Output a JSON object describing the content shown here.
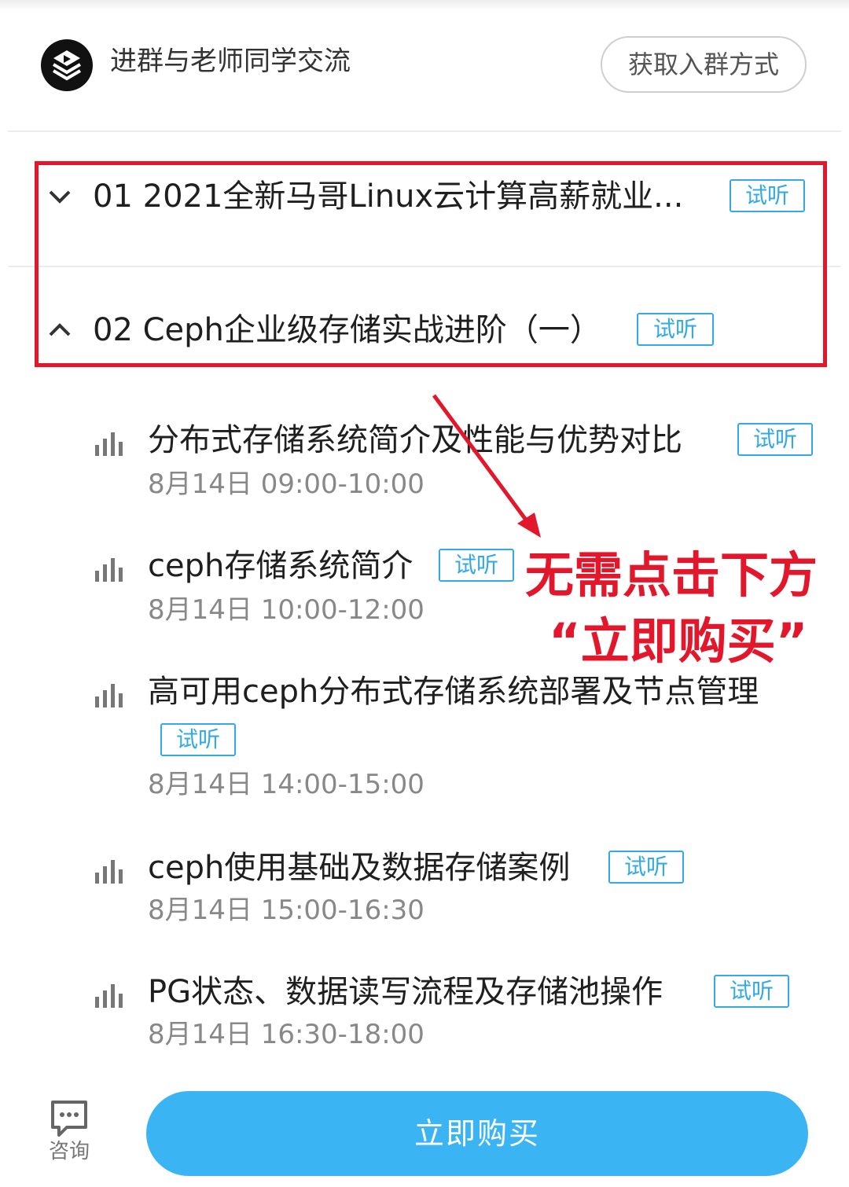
{
  "group": {
    "text": "进群与老师同学交流",
    "button_label": "获取入群方式"
  },
  "chapters": [
    {
      "title": "01 2021全新马哥Linux云计算高薪就业...",
      "tag": "试听",
      "state": "collapsed"
    },
    {
      "title": "02 Ceph企业级存储实战进阶（一）",
      "tag": "试听",
      "state": "expanded"
    }
  ],
  "lessons": [
    {
      "title": "分布式存储系统简介及性能与优势对比",
      "tag": "试听",
      "time": "8月14日 09:00-10:00"
    },
    {
      "title": "ceph存储系统简介",
      "tag": "试听",
      "time": "8月14日 10:00-12:00"
    },
    {
      "title": "高可用ceph分布式存储系统部署及节点管理",
      "tag": "试听",
      "time": "8月14日 14:00-15:00"
    },
    {
      "title": "ceph使用基础及数据存储案例",
      "tag": "试听",
      "time": "8月14日 15:00-16:30"
    },
    {
      "title": "PG状态、数据读写流程及存储池操作",
      "tag": "试听",
      "time": "8月14日 16:30-18:00"
    }
  ],
  "annotation": {
    "line1": "无需点击下方",
    "line2": "“立即购买”",
    "color": "#e3172b"
  },
  "bottom": {
    "consult_label": "咨询",
    "buy_label": "立即购买",
    "accent": "#3ab4f2"
  },
  "colors": {
    "tag": "#33a9e6",
    "highlight": "#e3172b"
  }
}
